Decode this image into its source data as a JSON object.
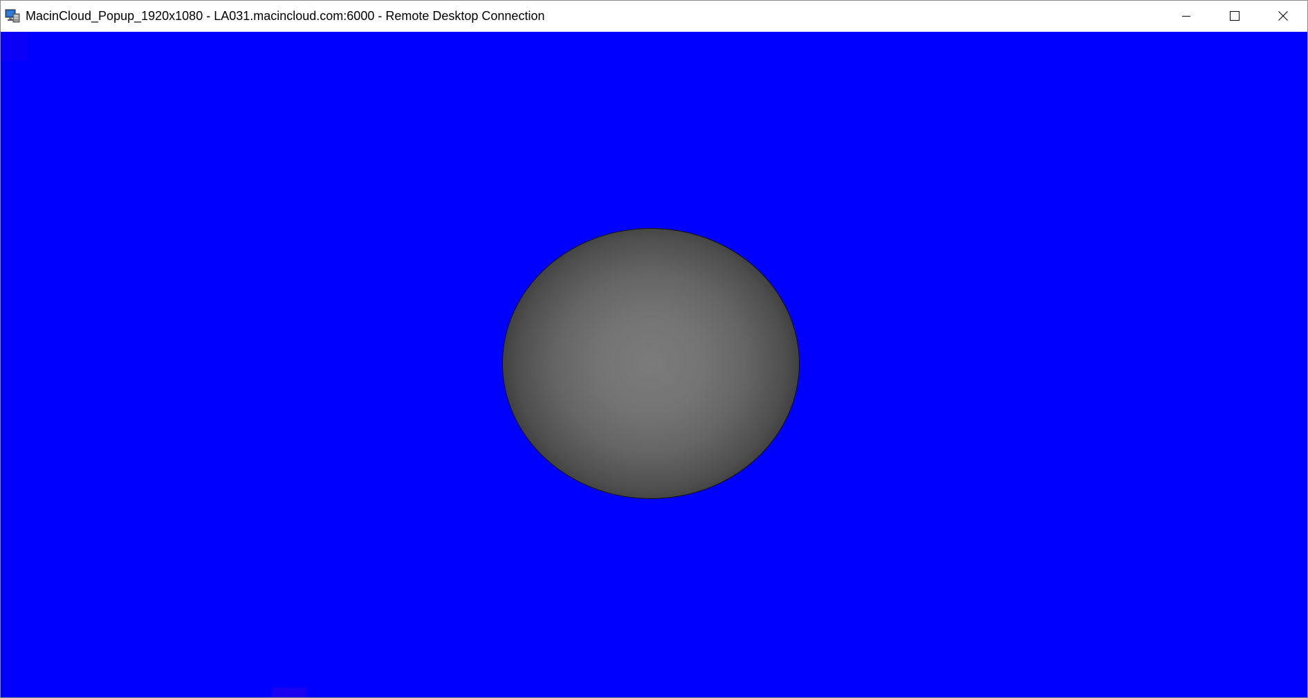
{
  "window": {
    "title": "MacinCloud_Popup_1920x1080 - LA031.macincloud.com:6000 - Remote Desktop Connection",
    "app_icon": "remote-desktop-icon",
    "controls": {
      "minimize": "minimize-icon",
      "maximize": "maximize-icon",
      "close": "close-icon"
    }
  },
  "remote_session": {
    "background_color": "#0000ff",
    "scene_object": "sphere",
    "sphere_color": "#747474"
  }
}
